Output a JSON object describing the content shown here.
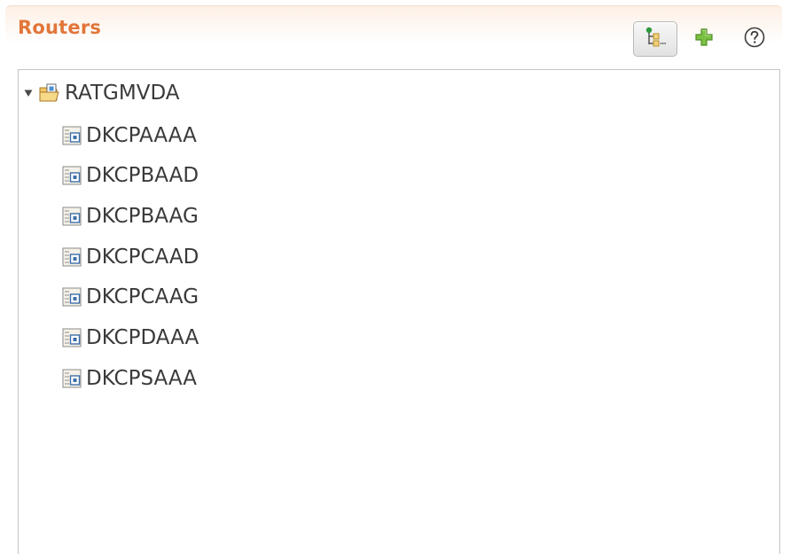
{
  "panel": {
    "title": "Routers",
    "accent_color": "#e2763a"
  },
  "toolbar": {
    "tree_view_icon": "tree-view-icon",
    "add_icon": "add-icon",
    "help_icon": "help-icon"
  },
  "tree": {
    "root": {
      "label": "RATGMVDA",
      "icon": "folder-icon",
      "expanded": true
    },
    "children": [
      {
        "label": "DKCPAAAA",
        "icon": "router-file-icon"
      },
      {
        "label": "DKCPBAAD",
        "icon": "router-file-icon"
      },
      {
        "label": "DKCPBAAG",
        "icon": "router-file-icon"
      },
      {
        "label": "DKCPCAAD",
        "icon": "router-file-icon"
      },
      {
        "label": "DKCPCAAG",
        "icon": "router-file-icon"
      },
      {
        "label": "DKCPDAAA",
        "icon": "router-file-icon"
      },
      {
        "label": "DKCPSAAA",
        "icon": "router-file-icon"
      }
    ]
  }
}
